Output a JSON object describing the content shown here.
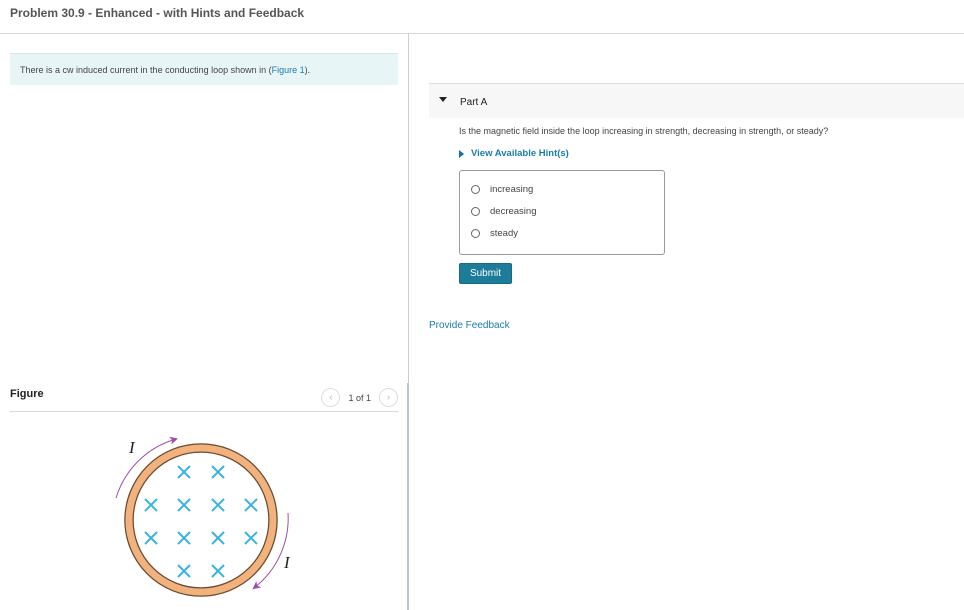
{
  "header": {
    "title": "Problem 30.9 - Enhanced - with Hints and Feedback"
  },
  "intro": {
    "text_before": "There is a cw induced current in the conducting loop shown in (",
    "link": "Figure 1",
    "text_after": ")."
  },
  "figure": {
    "title": "Figure",
    "counter": "1 of 1",
    "prev_icon": "chevron-left-icon",
    "next_icon": "chevron-right-icon",
    "current_label": "I",
    "field_symbol": "×",
    "colors": {
      "loop": "#f2b27e",
      "loop_edge": "#6b4a2e",
      "field": "#3bb3dd",
      "current_arrow": "#9b4fa8"
    }
  },
  "part": {
    "title": "Part A",
    "question": "Is the magnetic field inside the loop increasing in strength, decreasing in strength, or steady?",
    "hints_label": "View Available Hint(s)",
    "options": [
      {
        "label": "increasing",
        "selected": false
      },
      {
        "label": "decreasing",
        "selected": false
      },
      {
        "label": "steady",
        "selected": false
      }
    ],
    "submit_label": "Submit"
  },
  "footer": {
    "feedback_label": "Provide Feedback"
  },
  "colors": {
    "accent": "#1c7c9a",
    "link": "#1a7da8",
    "intro_bg": "#e8f5f6",
    "part_header_bg": "#f7f7f7"
  }
}
